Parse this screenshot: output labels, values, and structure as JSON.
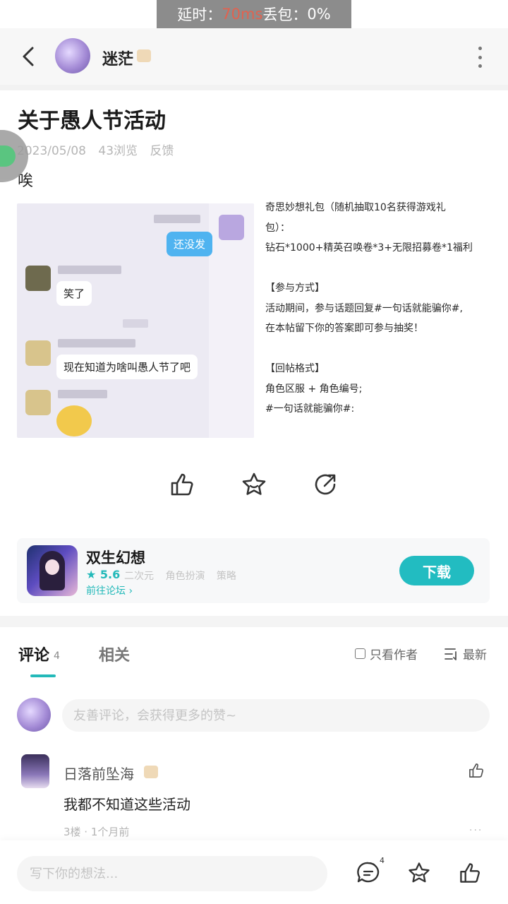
{
  "overlay": {
    "latency_label": "延时：",
    "latency_value": "70ms",
    "loss_label": " 丢包：",
    "loss_value": "0%"
  },
  "header": {
    "author": "迷茫",
    "icons": {
      "back": "back-arrow-icon",
      "more": "more-vertical-icon"
    }
  },
  "post": {
    "title": "关于愚人节活动",
    "date": "2023/05/08",
    "views": "43浏览",
    "category": "反馈",
    "body": "唉"
  },
  "chat_image": {
    "bubbles": [
      "还没发",
      "笑了",
      "现在知道为啥叫愚人节了吧"
    ]
  },
  "rules_text": [
    "奇思妙想礼包（随机抽取10名获得游戏礼",
    "包）：",
    "钻石*1000+精英召唤卷*3+无限招募卷*1福利",
    "",
    "【参与方式】",
    " 活动期间，参与话题回复#一句话就能骗你#,",
    "在本帖留下你的答案即可参与抽奖！",
    "",
    "【回帖格式】",
    "角色区服 + 角色编号;",
    "#一句话就能骗你#:"
  ],
  "actions": {
    "like": "thumbs-up-icon",
    "favorite": "star-icon",
    "share": "share-icon"
  },
  "game": {
    "name": "双生幻想",
    "score": "5.6",
    "tags": [
      "二次元",
      "角色扮演",
      "策略"
    ],
    "forum_link": "前往论坛 ›",
    "download_label": "下载",
    "accent": "#22bcc1"
  },
  "comments_section": {
    "tab_comments": "评论",
    "comment_count": "4",
    "tab_related": "相关",
    "only_author": "只看作者",
    "sort": "最新",
    "input_placeholder": "友善评论，会获得更多的赞~"
  },
  "comments": [
    {
      "user": "日落前坠海",
      "text": "我都不知道这些活动",
      "meta": "3楼 · 1个月前",
      "more": "···"
    }
  ],
  "bottom_bar": {
    "placeholder": "写下你的想法...",
    "comment_badge": "4"
  }
}
